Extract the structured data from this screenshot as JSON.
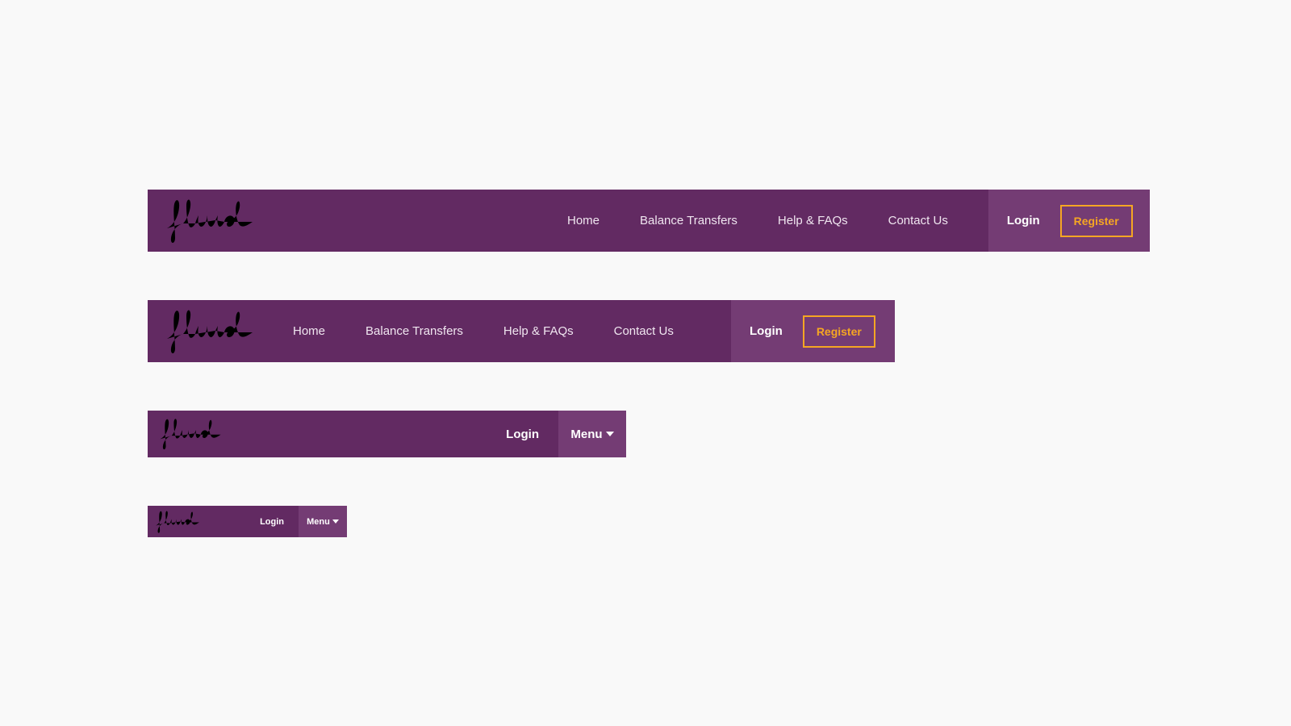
{
  "brand": {
    "logo_icon": "fluid-script-logo-icon",
    "primary_color": "#622a62",
    "panel_color": "#743c74",
    "accent_color": "#f5a623"
  },
  "navbar_desktop_wide": {
    "nav_items": [
      "Home",
      "Balance Transfers",
      "Help & FAQs",
      "Contact Us"
    ],
    "login_label": "Login",
    "register_label": "Register"
  },
  "navbar_desktop": {
    "nav_items": [
      "Home",
      "Balance Transfers",
      "Help & FAQs",
      "Contact Us"
    ],
    "login_label": "Login",
    "register_label": "Register"
  },
  "navbar_tablet": {
    "login_label": "Login",
    "menu_label": "Menu",
    "menu_icon": "caret-down-icon"
  },
  "navbar_mobile": {
    "login_label": "Login",
    "menu_label": "Menu",
    "menu_icon": "caret-down-icon"
  }
}
